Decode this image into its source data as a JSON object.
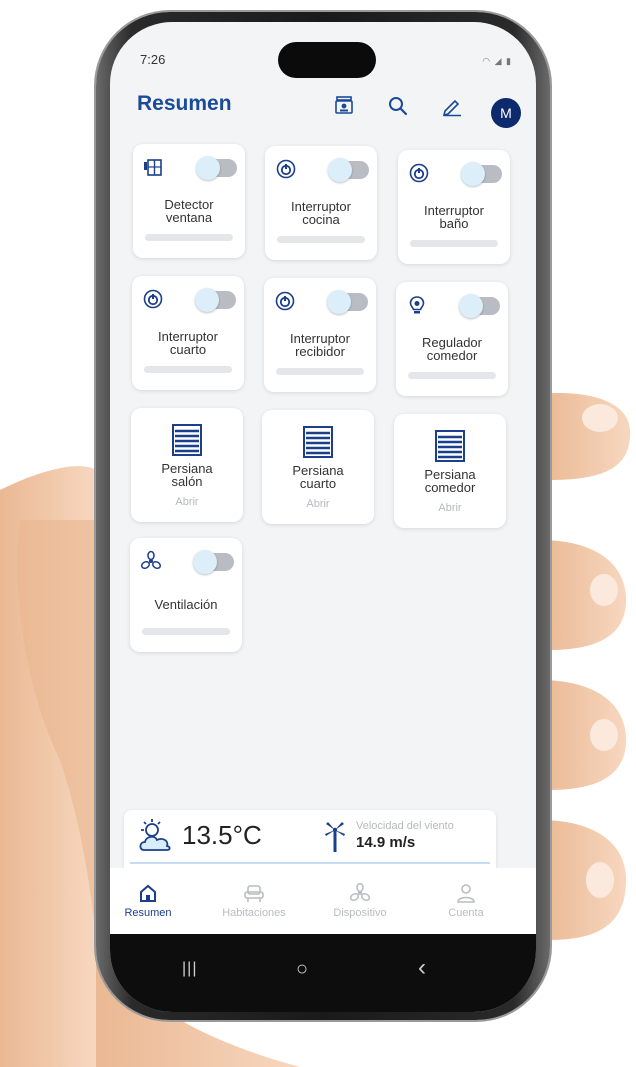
{
  "status": {
    "time": "7:26",
    "icons": "◠ ◢ ▮"
  },
  "header": {
    "title": "Resumen",
    "avatar_initial": "M"
  },
  "devices": [
    {
      "name_line1": "Detector",
      "name_line2": "ventana",
      "icon": "window-sensor-icon",
      "type": "switch"
    },
    {
      "name_line1": "Interruptor",
      "name_line2": "cocina",
      "icon": "power-icon",
      "type": "switch"
    },
    {
      "name_line1": "Interruptor",
      "name_line2": "baño",
      "icon": "power-icon",
      "type": "switch"
    },
    {
      "name_line1": "Interruptor",
      "name_line2": "cuarto",
      "icon": "power-icon",
      "type": "switch"
    },
    {
      "name_line1": "Interruptor",
      "name_line2": "recibidor",
      "icon": "power-icon",
      "type": "switch"
    },
    {
      "name_line1": "Regulador",
      "name_line2": "comedor",
      "icon": "bulb-icon",
      "type": "switch"
    },
    {
      "name_line1": "Persiana",
      "name_line2": "salón",
      "action": "Abrir",
      "icon": "blind-icon",
      "type": "blind"
    },
    {
      "name_line1": "Persiana",
      "name_line2": "cuarto",
      "action": "Abrir",
      "icon": "blind-icon",
      "type": "blind"
    },
    {
      "name_line1": "Persiana",
      "name_line2": "comedor",
      "action": "Abrir",
      "icon": "blind-icon",
      "type": "blind"
    },
    {
      "name_line1": "Ventilación",
      "name_line2": "",
      "icon": "fan-icon",
      "type": "switch"
    }
  ],
  "weather": {
    "temperature": "13.5°C",
    "wind_label": "Velocidad del viento",
    "wind_value": "14.9 m/s"
  },
  "nav": {
    "items": [
      {
        "label": "Resumen",
        "active": true
      },
      {
        "label": "Habitaciones",
        "active": false
      },
      {
        "label": "Dispositivo",
        "active": false
      },
      {
        "label": "Cuenta",
        "active": false
      }
    ]
  },
  "system_nav": {
    "recent": "|||",
    "home": "○",
    "back": "‹"
  },
  "colors": {
    "accent": "#1b4a96",
    "avatar": "#0d2a6e",
    "skin": "#f2c8a8"
  }
}
